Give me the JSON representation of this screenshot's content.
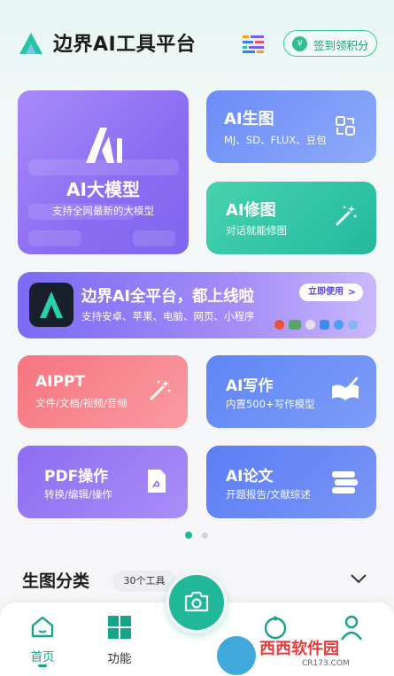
{
  "header": {
    "app_title": "边界AI工具平台",
    "signin_label": "签到领积分",
    "coin_glyph": "¥"
  },
  "cards": {
    "model": {
      "title": "AI大模型",
      "subtitle": "支持全网最新的大模型"
    },
    "generate": {
      "title": "AI生图",
      "subtitle": "MJ、SD、FLUX、豆包"
    },
    "edit": {
      "title": "AI修图",
      "subtitle": "对话就能修图"
    },
    "ppt": {
      "title": "AIPPT",
      "subtitle": "文件/文档/视频/音频"
    },
    "write": {
      "title": "AI写作",
      "subtitle": "内置500+写作模型"
    },
    "pdf": {
      "title": "PDF操作",
      "subtitle": "转换/编辑/操作"
    },
    "paper": {
      "title": "AI论文",
      "subtitle": "开题报告/文献综述"
    }
  },
  "banner": {
    "title": "边界AI全平台，都上线啦",
    "subtitle": "支持安卓、苹果、电脑、网页、小程序",
    "button": "立即使用"
  },
  "carousel": {
    "pages": 2,
    "active_index": 0
  },
  "category": {
    "title": "生图分类",
    "count": "30个工具"
  },
  "nav": {
    "items": [
      {
        "label": "首页",
        "icon": "home-icon",
        "active": true
      },
      {
        "label": "功能",
        "icon": "grid-icon",
        "active": false
      }
    ]
  },
  "watermark": {
    "main": "西西软件园",
    "domain": "CR173.COM"
  },
  "colors": {
    "accent": "#20b899",
    "model_card": "#8a6cf2",
    "generate_card": "#6b8cf7",
    "edit_card": "#23b9a0",
    "ppt_card": "#f6747f",
    "write_card": "#5e86f5",
    "pdf_card": "#8c6df2",
    "paper_card": "#5a7ef4"
  }
}
